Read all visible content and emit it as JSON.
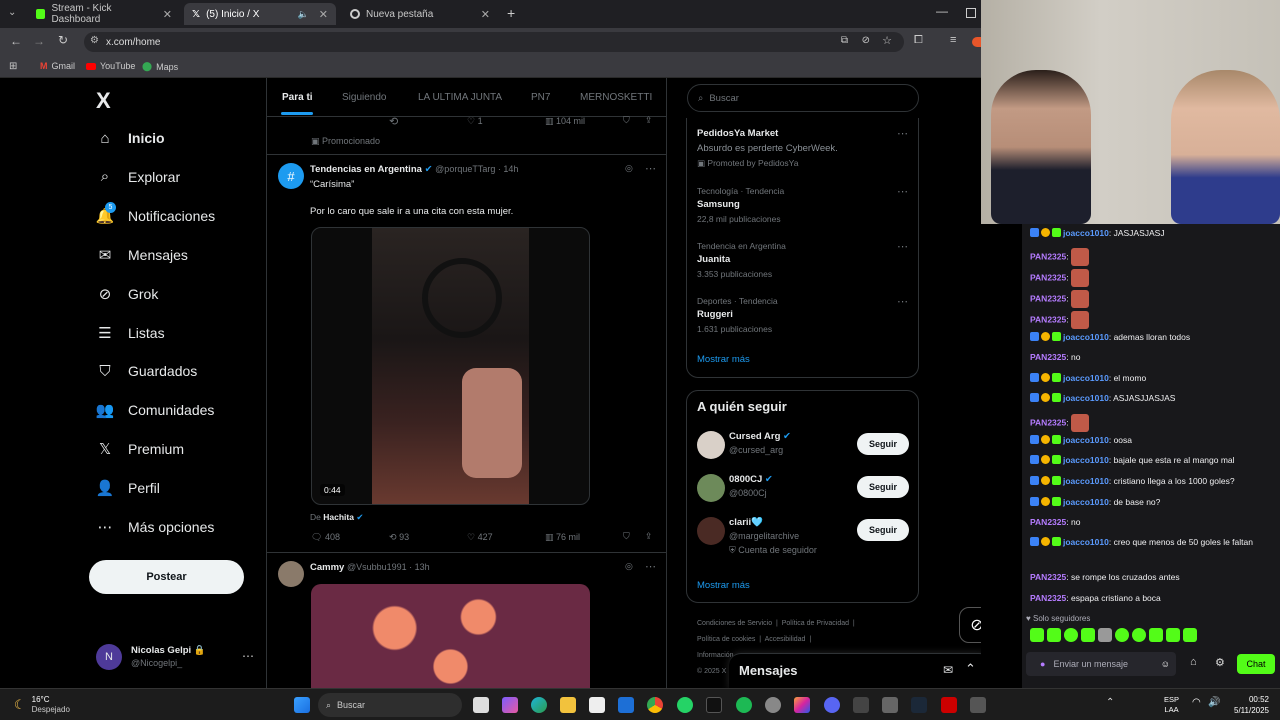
{
  "browser": {
    "tabs": [
      {
        "label": "Stream - Kick Dashboard"
      },
      {
        "label": "(5) Inicio / X"
      },
      {
        "label": "Nueva pestaña"
      }
    ],
    "url": "x.com/home",
    "bookmarks": [
      "Gmail",
      "YouTube",
      "Maps"
    ]
  },
  "sidebar": {
    "logo": "X",
    "items": [
      {
        "label": "Inicio",
        "icon": "home-icon"
      },
      {
        "label": "Explorar",
        "icon": "search-icon"
      },
      {
        "label": "Notificaciones",
        "icon": "bell-icon",
        "badge": "5"
      },
      {
        "label": "Mensajes",
        "icon": "mail-icon"
      },
      {
        "label": "Grok",
        "icon": "grok-icon"
      },
      {
        "label": "Listas",
        "icon": "list-icon"
      },
      {
        "label": "Guardados",
        "icon": "bookmark-icon"
      },
      {
        "label": "Comunidades",
        "icon": "people-icon"
      },
      {
        "label": "Premium",
        "icon": "x-icon"
      },
      {
        "label": "Perfil",
        "icon": "person-icon"
      },
      {
        "label": "Más opciones",
        "icon": "more-icon"
      }
    ],
    "post_button": "Postear",
    "user": {
      "name": "Nicolas Gelpi",
      "handle": "@Nicogelpi_",
      "initial": "N"
    }
  },
  "timeline": {
    "tabs": [
      "Para ti",
      "Siguiendo",
      "LA ULTIMA JUNTA",
      "PN7",
      "MERNOSKETTI"
    ],
    "prev_post": {
      "likes": "1",
      "views": "104 mil",
      "promoted": "Promocionado"
    },
    "post1": {
      "name": "Tendencias en Argentina",
      "handle": "@porqueTTarg · 14h",
      "quote": "“Carísima”",
      "text": "Por lo caro que sale ir a una cita con esta mujer.",
      "video_time": "0:44",
      "from_label": "De",
      "from_user": "Hachita",
      "replies": "408",
      "reposts": "93",
      "likes": "427",
      "views": "76 mil"
    },
    "post2": {
      "name": "Cammy",
      "handle": "@Vsubbu1991 · 13h"
    }
  },
  "right": {
    "search_placeholder": "Buscar",
    "ad": {
      "title": "PedidosYa Market",
      "text": "Absurdo es perderte CyberWeek.",
      "promoted": "Promoted by PedidosYa"
    },
    "trends": [
      {
        "meta": "Tecnología · Tendencia",
        "name": "Samsung",
        "count": "22,8 mil publicaciones"
      },
      {
        "meta": "Tendencia en Argentina",
        "name": "Juanita",
        "count": "3.353 publicaciones"
      },
      {
        "meta": "Deportes · Tendencia",
        "name": "Ruggeri",
        "count": "1.631 publicaciones"
      }
    ],
    "show_more": "Mostrar más",
    "who_to_follow": "A quién seguir",
    "follow_btn": "Seguir",
    "suggestions": [
      {
        "name": "Cursed Arg",
        "handle": "@cursed_arg",
        "extra": ""
      },
      {
        "name": "0800CJ",
        "handle": "@0800Cj",
        "extra": ""
      },
      {
        "name": "clarii🩵",
        "handle": "@margelitarchive",
        "extra": "Cuenta de seguidor"
      }
    ],
    "footer": [
      "Condiciones de Servicio",
      "Política de Privacidad",
      "Política de cookies",
      "Accesibilidad",
      "Información",
      "© 2025 X"
    ],
    "messages_label": "Mensajes"
  },
  "chat": {
    "messages": [
      {
        "user": "joacco1010",
        "text": "JASJASJASJ",
        "badges": true
      },
      {
        "user": "PAN2325",
        "text": "",
        "emote": true
      },
      {
        "user": "PAN2325",
        "text": "",
        "emote": true
      },
      {
        "user": "PAN2325",
        "text": "",
        "emote": true
      },
      {
        "user": "PAN2325",
        "text": "",
        "emote": true
      },
      {
        "user": "joacco1010",
        "text": "ademas lloran todos",
        "badges": true
      },
      {
        "user": "PAN2325",
        "text": "no"
      },
      {
        "user": "joacco1010",
        "text": "el momo",
        "badges": true
      },
      {
        "user": "joacco1010",
        "text": "ASJASJJASJAS",
        "badges": true
      },
      {
        "user": "PAN2325",
        "text": "",
        "emote": true
      },
      {
        "user": "joacco1010",
        "text": "oosa",
        "badges": true
      },
      {
        "user": "joacco1010",
        "text": "bajale que esta re al mango mal",
        "badges": true
      },
      {
        "user": "joacco1010",
        "text": "cristiano llega a los 1000 goles?",
        "badges": true
      },
      {
        "user": "joacco1010",
        "text": "de base no?",
        "badges": true
      },
      {
        "user": "PAN2325",
        "text": "no"
      },
      {
        "user": "joacco1010",
        "text": "creo que menos de 50 goles le faltan",
        "badges": true
      },
      {
        "user": "PAN2325",
        "text": "se rompe los cruzados antes"
      },
      {
        "user": "PAN2325",
        "text": "espapa cristiano a boca"
      }
    ],
    "followers_only": "Solo seguidores",
    "input_placeholder": "Enviar un mensaje",
    "chat_button": "Chat",
    "colors": {
      "joacco": "#5b9bff",
      "pan": "#b57cff",
      "kick_green": "#53fc18"
    }
  },
  "taskbar": {
    "weather_temp": "16°C",
    "weather_text": "Despejado",
    "search_placeholder": "Buscar",
    "lang1": "ESP",
    "lang2": "LAA",
    "time": "00:52",
    "date": "5/11/2025"
  }
}
